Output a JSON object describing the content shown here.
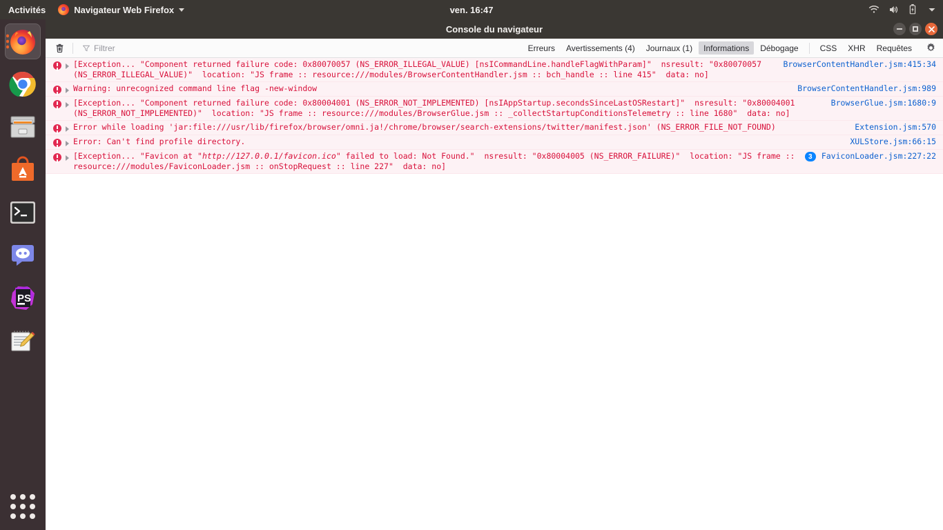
{
  "topbar": {
    "activities": "Activités",
    "app_name": "Navigateur Web Firefox",
    "clock": "ven. 16:47",
    "icons": [
      "firefox-logo",
      "chevron-down-icon",
      "wifi-icon",
      "volume-icon",
      "battery-icon",
      "system-menu-chevron-icon"
    ]
  },
  "dock": {
    "items": [
      {
        "name": "firefox",
        "active": true
      },
      {
        "name": "google-chrome",
        "active": false
      },
      {
        "name": "file-manager",
        "active": false
      },
      {
        "name": "ubuntu-software",
        "active": false
      },
      {
        "name": "terminal",
        "active": false
      },
      {
        "name": "discord",
        "active": false
      },
      {
        "name": "phpstorm",
        "active": false
      },
      {
        "name": "text-editor",
        "active": false
      }
    ],
    "show_apps_label": "Afficher les applications"
  },
  "window": {
    "title": "Console du navigateur",
    "buttons": {
      "minimize": "−",
      "maximize": "□",
      "close": "×"
    }
  },
  "toolbar": {
    "clear_label": "Effacer",
    "filter_placeholder": "Filtrer",
    "filters": [
      {
        "label": "Erreurs",
        "active": false
      },
      {
        "label": "Avertissements (4)",
        "active": false
      },
      {
        "label": "Journaux (1)",
        "active": false
      },
      {
        "label": "Informations",
        "active": true
      },
      {
        "label": "Débogage",
        "active": false
      }
    ],
    "filters_right": [
      {
        "label": "CSS",
        "active": false
      },
      {
        "label": "XHR",
        "active": false
      },
      {
        "label": "Requêtes",
        "active": false
      }
    ],
    "settings_label": "Paramètres"
  },
  "messages": [
    {
      "level": "error",
      "text": "[Exception... \"Component returned failure code: 0x80070057 (NS_ERROR_ILLEGAL_VALUE) [nsICommandLine.handleFlagWithParam]\"  nsresult: \"0x80070057\n(NS_ERROR_ILLEGAL_VALUE)\"  location: \"JS frame :: resource:///modules/BrowserContentHandler.jsm :: bch_handle :: line 415\"  data: no]",
      "source": "BrowserContentHandler.jsm:415:34",
      "repeats": null
    },
    {
      "level": "error",
      "text": "Warning: unrecognized command line flag -new-window",
      "source": "BrowserContentHandler.jsm:989",
      "repeats": null
    },
    {
      "level": "error",
      "text": "[Exception... \"Component returned failure code: 0x80004001 (NS_ERROR_NOT_IMPLEMENTED) [nsIAppStartup.secondsSinceLastOSRestart]\"  nsresult: \"0x80004001\n(NS_ERROR_NOT_IMPLEMENTED)\"  location: \"JS frame :: resource:///modules/BrowserGlue.jsm :: _collectStartupConditionsTelemetry :: line 1680\"  data: no]",
      "source": "BrowserGlue.jsm:1680:9",
      "repeats": null
    },
    {
      "level": "error",
      "text": "Error while loading 'jar:file:///usr/lib/firefox/browser/omni.ja!/chrome/browser/search-extensions/twitter/manifest.json' (NS_ERROR_FILE_NOT_FOUND)",
      "source": "Extension.jsm:570",
      "repeats": null
    },
    {
      "level": "error",
      "text": "Error: Can't find profile directory.",
      "source": "XULStore.jsm:66:15",
      "repeats": null
    },
    {
      "level": "error",
      "text_pre": "[Exception... \"Favicon at \"",
      "text_italic": "http://127.0.0.1/favicon.ico",
      "text_post": "\" failed to load: Not Found.\"  nsresult: \"0x80004005 (NS_ERROR_FAILURE)\"  location: \"JS frame ::\nresource:///modules/FaviconLoader.jsm :: onStopRequest :: line 227\"  data: no]",
      "source": "FaviconLoader.jsm:227:22",
      "repeats": "3"
    }
  ],
  "colors": {
    "error_text": "#d8103a",
    "error_row_bg": "#fdf2f5",
    "link": "#0b60cf",
    "badge": "#0a84ff",
    "topbar_bg": "#3a3733",
    "dock_bg": "#3b3033",
    "active_filter_bg": "#d7d7db"
  }
}
